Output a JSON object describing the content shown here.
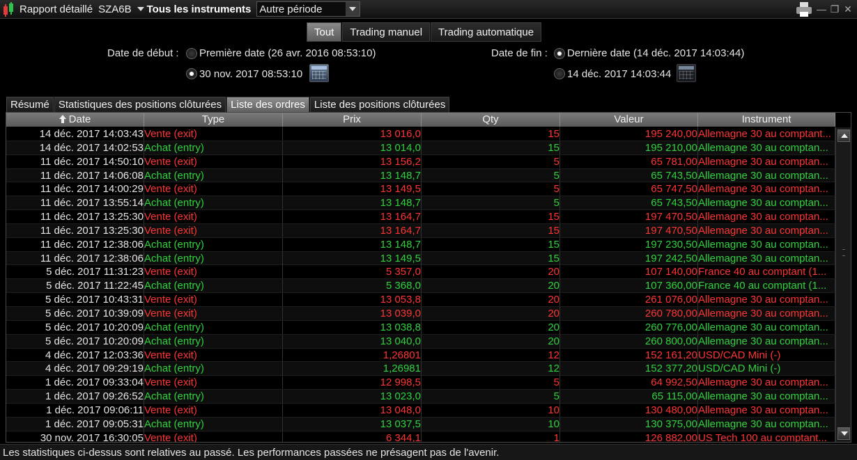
{
  "titlebar": {
    "title": "Rapport détaillé",
    "account": "SZA6B",
    "instruments": "Tous les instruments",
    "period": "Autre période"
  },
  "filter_tabs": [
    {
      "label": "Tout",
      "active": true
    },
    {
      "label": "Trading manuel",
      "active": false
    },
    {
      "label": "Trading automatique",
      "active": false
    }
  ],
  "dates": {
    "start_label": "Date de début :",
    "start_first": "Première date (26 avr. 2016 08:53:10)",
    "start_custom": "30 nov. 2017 08:53:10",
    "end_label": "Date de fin :",
    "end_last": "Dernière date (14 déc. 2017 14:03:44)",
    "end_custom": "14 déc. 2017 14:03:44"
  },
  "report_tabs": [
    {
      "label": "Résumé",
      "active": false
    },
    {
      "label": "Statistiques des positions clôturées",
      "active": false
    },
    {
      "label": "Liste des ordres",
      "active": true
    },
    {
      "label": "Liste des positions clôturées",
      "active": false
    }
  ],
  "table": {
    "columns": [
      "Date",
      "Type",
      "Prix",
      "Qty",
      "Valeur",
      "Instrument"
    ],
    "rows": [
      {
        "date": "14 déc. 2017 14:03:43",
        "type": "Vente (exit)",
        "prix": "13 016,0",
        "qty": "15",
        "valeur": "195 240,00",
        "instrument": "Allemagne 30 au comptant...",
        "side": "sell"
      },
      {
        "date": "14 déc. 2017 14:02:53",
        "type": "Achat (entry)",
        "prix": "13 014,0",
        "qty": "15",
        "valeur": "195 210,00",
        "instrument": "Allemagne 30 au comptan...",
        "side": "buy"
      },
      {
        "date": "11 déc. 2017 14:50:10",
        "type": "Vente (exit)",
        "prix": "13 156,2",
        "qty": "5",
        "valeur": "65 781,00",
        "instrument": "Allemagne 30 au comptan...",
        "side": "sell"
      },
      {
        "date": "11 déc. 2017 14:06:08",
        "type": "Achat (entry)",
        "prix": "13 148,7",
        "qty": "5",
        "valeur": "65 743,50",
        "instrument": "Allemagne 30 au comptan...",
        "side": "buy"
      },
      {
        "date": "11 déc. 2017 14:00:29",
        "type": "Vente (exit)",
        "prix": "13 149,5",
        "qty": "5",
        "valeur": "65 747,50",
        "instrument": "Allemagne 30 au comptan...",
        "side": "sell"
      },
      {
        "date": "11 déc. 2017 13:55:14",
        "type": "Achat (entry)",
        "prix": "13 148,7",
        "qty": "5",
        "valeur": "65 743,50",
        "instrument": "Allemagne 30 au comptan...",
        "side": "buy"
      },
      {
        "date": "11 déc. 2017 13:25:30",
        "type": "Vente (exit)",
        "prix": "13 164,7",
        "qty": "15",
        "valeur": "197 470,50",
        "instrument": "Allemagne 30 au comptan...",
        "side": "sell"
      },
      {
        "date": "11 déc. 2017 13:25:30",
        "type": "Vente (exit)",
        "prix": "13 164,7",
        "qty": "15",
        "valeur": "197 470,50",
        "instrument": "Allemagne 30 au comptan...",
        "side": "sell"
      },
      {
        "date": "11 déc. 2017 12:38:06",
        "type": "Achat (entry)",
        "prix": "13 148,7",
        "qty": "15",
        "valeur": "197 230,50",
        "instrument": "Allemagne 30 au comptan...",
        "side": "buy"
      },
      {
        "date": "11 déc. 2017 12:38:06",
        "type": "Achat (entry)",
        "prix": "13 149,5",
        "qty": "15",
        "valeur": "197 242,50",
        "instrument": "Allemagne 30 au comptan...",
        "side": "buy"
      },
      {
        "date": "5 déc. 2017 11:31:23",
        "type": "Vente (exit)",
        "prix": "5 357,0",
        "qty": "20",
        "valeur": "107 140,00",
        "instrument": "France 40 au comptant (1...",
        "side": "sell"
      },
      {
        "date": "5 déc. 2017 11:22:45",
        "type": "Achat (entry)",
        "prix": "5 368,0",
        "qty": "20",
        "valeur": "107 360,00",
        "instrument": "France 40 au comptant (1...",
        "side": "buy"
      },
      {
        "date": "5 déc. 2017 10:43:31",
        "type": "Vente (exit)",
        "prix": "13 053,8",
        "qty": "20",
        "valeur": "261 076,00",
        "instrument": "Allemagne 30 au comptan...",
        "side": "sell"
      },
      {
        "date": "5 déc. 2017 10:39:09",
        "type": "Vente (exit)",
        "prix": "13 039,0",
        "qty": "20",
        "valeur": "260 780,00",
        "instrument": "Allemagne 30 au comptan...",
        "side": "sell"
      },
      {
        "date": "5 déc. 2017 10:20:09",
        "type": "Achat (entry)",
        "prix": "13 038,8",
        "qty": "20",
        "valeur": "260 776,00",
        "instrument": "Allemagne 30 au comptan...",
        "side": "buy"
      },
      {
        "date": "5 déc. 2017 10:20:09",
        "type": "Achat (entry)",
        "prix": "13 040,0",
        "qty": "20",
        "valeur": "260 800,00",
        "instrument": "Allemagne 30 au comptan...",
        "side": "buy"
      },
      {
        "date": "4 déc. 2017 12:03:36",
        "type": "Vente (exit)",
        "prix": "1,26801",
        "qty": "12",
        "valeur": "152 161,20",
        "instrument": "USD/CAD Mini (-)",
        "side": "sell"
      },
      {
        "date": "4 déc. 2017 09:29:19",
        "type": "Achat (entry)",
        "prix": "1,26981",
        "qty": "12",
        "valeur": "152 377,20",
        "instrument": "USD/CAD Mini (-)",
        "side": "buy"
      },
      {
        "date": "1 déc. 2017 09:33:04",
        "type": "Vente (exit)",
        "prix": "12 998,5",
        "qty": "5",
        "valeur": "64 992,50",
        "instrument": "Allemagne 30 au comptan...",
        "side": "sell"
      },
      {
        "date": "1 déc. 2017 09:26:52",
        "type": "Achat (entry)",
        "prix": "13 023,0",
        "qty": "5",
        "valeur": "65 115,00",
        "instrument": "Allemagne 30 au comptan...",
        "side": "buy"
      },
      {
        "date": "1 déc. 2017 09:06:11",
        "type": "Vente (exit)",
        "prix": "13 048,0",
        "qty": "10",
        "valeur": "130 480,00",
        "instrument": "Allemagne 30 au comptan...",
        "side": "sell"
      },
      {
        "date": "1 déc. 2017 09:05:31",
        "type": "Achat (entry)",
        "prix": "13 037,5",
        "qty": "10",
        "valeur": "130 375,00",
        "instrument": "Allemagne 30 au comptan...",
        "side": "buy"
      },
      {
        "date": "30 nov. 2017 16:30:05",
        "type": "Vente (exit)",
        "prix": "6 344,1",
        "qty": "1",
        "valeur": "126 882,00",
        "instrument": "US Tech 100 au comptant...",
        "side": "sell"
      }
    ]
  },
  "footer": {
    "text": "Les statistiques ci-dessus sont relatives au passé. Les performances passées ne présagent pas de l'avenir."
  },
  "colors": {
    "sell": "#ff3535",
    "buy": "#30d33e"
  },
  "icons": {
    "app": "candlestick-icon",
    "print": "printer-icon",
    "calendar": "calendar-icon"
  }
}
